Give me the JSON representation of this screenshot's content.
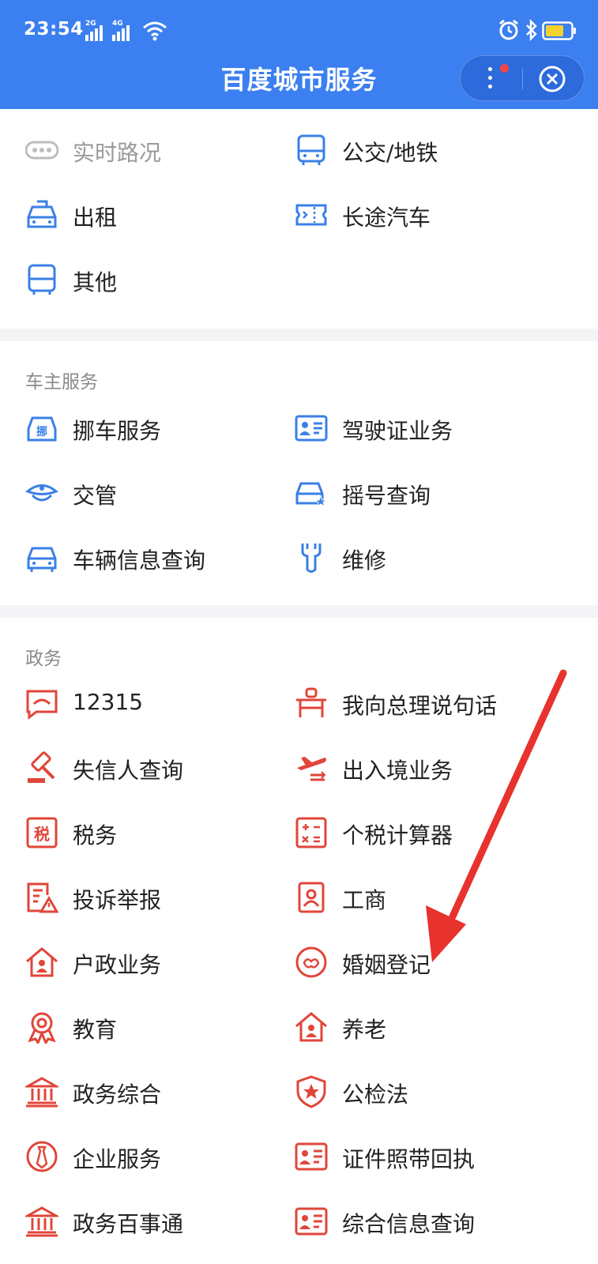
{
  "status": {
    "time": "23:54",
    "sim1": "2G",
    "sim2": "4G"
  },
  "header": {
    "title": "百度城市服务"
  },
  "colors": {
    "header_bg": "#3b7ff0",
    "blue_icon": "#3a80e6",
    "red_icon": "#e0463a",
    "arrow": "#e8322e"
  },
  "transport": {
    "items": [
      {
        "label": "实时路况",
        "icon": "traffic-dots-icon",
        "dim": true
      },
      {
        "label": "公交/地铁",
        "icon": "bus-icon"
      },
      {
        "label": "出租",
        "icon": "taxi-icon"
      },
      {
        "label": "长途汽车",
        "icon": "ticket-icon"
      },
      {
        "label": "其他",
        "icon": "bus-front-icon"
      }
    ]
  },
  "owner": {
    "title": "车主服务",
    "items": [
      {
        "label": "挪车服务",
        "icon": "move-car-icon"
      },
      {
        "label": "驾驶证业务",
        "icon": "license-card-icon"
      },
      {
        "label": "交管",
        "icon": "police-cap-icon"
      },
      {
        "label": "摇号查询",
        "icon": "car-star-icon"
      },
      {
        "label": "车辆信息查询",
        "icon": "car-icon"
      },
      {
        "label": "维修",
        "icon": "wrench-icon"
      }
    ]
  },
  "gov": {
    "title": "政务",
    "items": [
      {
        "label": "12315",
        "icon": "chat-icon"
      },
      {
        "label": "我向总理说句话",
        "icon": "podium-icon"
      },
      {
        "label": "失信人查询",
        "icon": "gavel-icon"
      },
      {
        "label": "出入境业务",
        "icon": "plane-icon"
      },
      {
        "label": "税务",
        "icon": "tax-icon"
      },
      {
        "label": "个税计算器",
        "icon": "calculator-icon"
      },
      {
        "label": "投诉举报",
        "icon": "report-icon"
      },
      {
        "label": "工商",
        "icon": "id-badge-icon"
      },
      {
        "label": "户政业务",
        "icon": "house-person-icon"
      },
      {
        "label": "婚姻登记",
        "icon": "marriage-icon"
      },
      {
        "label": "教育",
        "icon": "medal-icon"
      },
      {
        "label": "养老",
        "icon": "house-elder-icon"
      },
      {
        "label": "政务综合",
        "icon": "government-building-icon"
      },
      {
        "label": "公检法",
        "icon": "shield-star-icon"
      },
      {
        "label": "企业服务",
        "icon": "tie-icon"
      },
      {
        "label": "证件照带回执",
        "icon": "photo-id-icon"
      },
      {
        "label": "政务百事通",
        "icon": "government-building-icon"
      },
      {
        "label": "综合信息查询",
        "icon": "info-card-icon"
      }
    ]
  }
}
